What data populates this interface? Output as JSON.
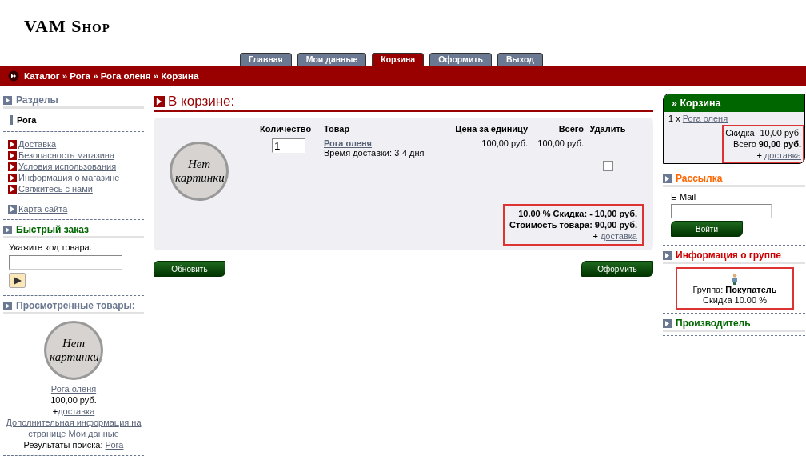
{
  "logo": "VAM Shop",
  "tabs": [
    {
      "label": "Главная",
      "selected": false
    },
    {
      "label": "Мои данные",
      "selected": false
    },
    {
      "label": "Корзина",
      "selected": true
    },
    {
      "label": "Оформить",
      "selected": false
    },
    {
      "label": "Выход",
      "selected": false
    }
  ],
  "breadcrumb": "Каталог » Рога » Рога оленя » Корзина",
  "sections": {
    "title": "Разделы",
    "categories": [
      {
        "label": "Рога",
        "selected": true
      }
    ],
    "info_links": [
      "Доставка",
      "Безопасность магазина",
      "Условия использования",
      "Информация о магазине",
      "Свяжитесь с нами"
    ],
    "sitemap": "Карта сайта"
  },
  "quick_order": {
    "title": "Быстрый заказ",
    "prompt": "Укажите код товара."
  },
  "viewed": {
    "title": "Просмотренные товары:",
    "image_text": "Нет картинки",
    "product": "Рога оленя",
    "price": "100,00 руб.",
    "shipping_prefix": "+",
    "shipping": "доставка",
    "more": "Дополнительная информация на странице Мои данные",
    "search_label": "Результаты поиска:",
    "search_link": "Рога"
  },
  "cart": {
    "title": "В корзине:",
    "columns": [
      "Количество",
      "Товар",
      "Цена за единицу",
      "Всего",
      "Удалить"
    ],
    "items": [
      {
        "image_text": "Нет картинки",
        "quantity": "1",
        "name": "Рога оленя",
        "delivery": "Время доставки: 3-4 дня",
        "unit_price": "100,00 руб.",
        "total": "100,00 руб.",
        "delete": false
      }
    ],
    "discount": "10.00 % Скидка: - 10,00 руб.",
    "subtotal": "Стоимость товара: 90,00 руб.",
    "shipping_prefix": "+",
    "shipping": "доставка",
    "buttons": [
      "Обновить",
      "Оформить"
    ]
  },
  "mini_cart": {
    "title": "» Корзина",
    "item_qty": "1 x",
    "item_name": "Рога оленя",
    "discount": "Скидка  -10,00 руб.",
    "total": "Всего  **90,00 руб.**",
    "shipping_prefix": "+",
    "shipping": "доставка"
  },
  "newsletter": {
    "title": "Рассылка",
    "label": "E-Mail",
    "button": "Войти"
  },
  "group_info": {
    "title": "Информация о группе",
    "group": "Группа: **Покупатель**",
    "discount": "Скидка 10.00 %"
  },
  "manufacturer": {
    "title": "Производитель"
  }
}
